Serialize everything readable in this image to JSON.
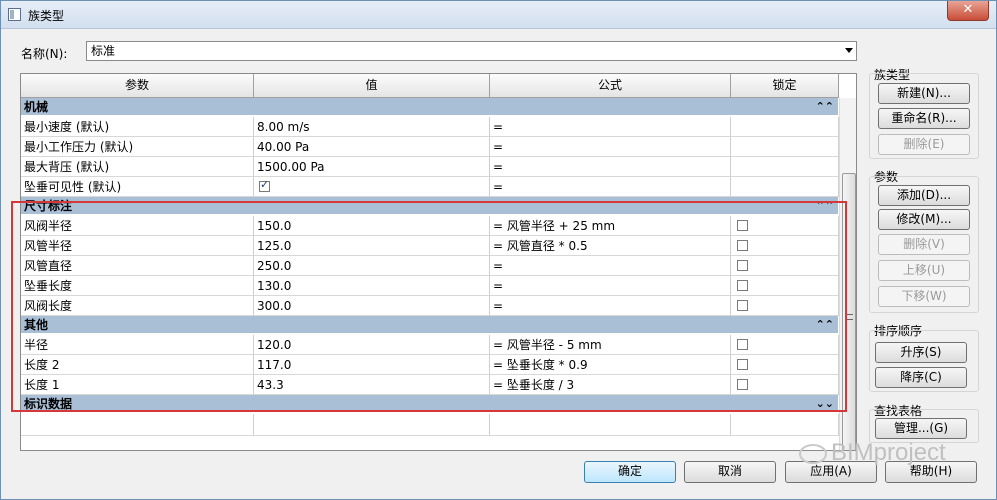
{
  "window": {
    "title": "族类型",
    "close_symbol": "✕"
  },
  "name_field": {
    "label": "名称(N):",
    "value": "标准"
  },
  "grid": {
    "headers": [
      "参数",
      "值",
      "公式",
      "锁定"
    ],
    "groups": [
      {
        "name": "机械",
        "chevron": "⌃⌃",
        "rows": [
          {
            "param": "最小速度 (默认)",
            "value": "8.00 m/s",
            "formula": "=",
            "lock": null
          },
          {
            "param": "最小工作压力 (默认)",
            "value": "40.00 Pa",
            "formula": "=",
            "lock": null
          },
          {
            "param": "最大背压 (默认)",
            "value": "1500.00 Pa",
            "formula": "=",
            "lock": null
          },
          {
            "param": "坠垂可见性 (默认)",
            "value": "",
            "checkbox_value": true,
            "formula": "=",
            "lock": null
          }
        ]
      },
      {
        "name": "尺寸标注",
        "chevron": "⌃⌃",
        "rows": [
          {
            "param": "风阀半径",
            "value": "150.0",
            "formula": "= 风管半径 + 25 mm",
            "lock": false
          },
          {
            "param": "风管半径",
            "value": "125.0",
            "formula": "= 风管直径 * 0.5",
            "lock": false
          },
          {
            "param": "风管直径",
            "value": "250.0",
            "formula": "=",
            "lock": false
          },
          {
            "param": "坠垂长度",
            "value": "130.0",
            "formula": "=",
            "lock": false
          },
          {
            "param": "风阀长度",
            "value": "300.0",
            "formula": "=",
            "lock": false
          }
        ]
      },
      {
        "name": "其他",
        "chevron": "⌃⌃",
        "rows": [
          {
            "param": "半径",
            "value": "120.0",
            "formula": "= 风管半径 - 5 mm",
            "lock": false
          },
          {
            "param": "长度 2",
            "value": "117.0",
            "formula": "= 坠垂长度 * 0.9",
            "lock": false
          },
          {
            "param": "长度 1",
            "value": "43.3",
            "formula": "= 坠垂长度 / 3",
            "lock": false
          }
        ]
      },
      {
        "name": "标识数据",
        "chevron": "⌄⌄",
        "rows": []
      }
    ]
  },
  "side_panel": {
    "family_types": {
      "title": "族类型",
      "new": "新建(N)...",
      "rename": "重命名(R)...",
      "delete": "删除(E)"
    },
    "parameters": {
      "title": "参数",
      "add": "添加(D)...",
      "modify": "修改(M)...",
      "remove": "删除(V)",
      "move_up": "上移(U)",
      "move_down": "下移(W)"
    },
    "sort_order": {
      "title": "排序顺序",
      "ascending": "升序(S)",
      "descending": "降序(C)"
    },
    "lookup_tables": {
      "title": "查找表格",
      "manage": "管理...(G)"
    }
  },
  "footer": {
    "ok": "确定",
    "cancel": "取消",
    "apply": "应用(A)",
    "help": "帮助(H)"
  },
  "watermark": "BIMproject"
}
